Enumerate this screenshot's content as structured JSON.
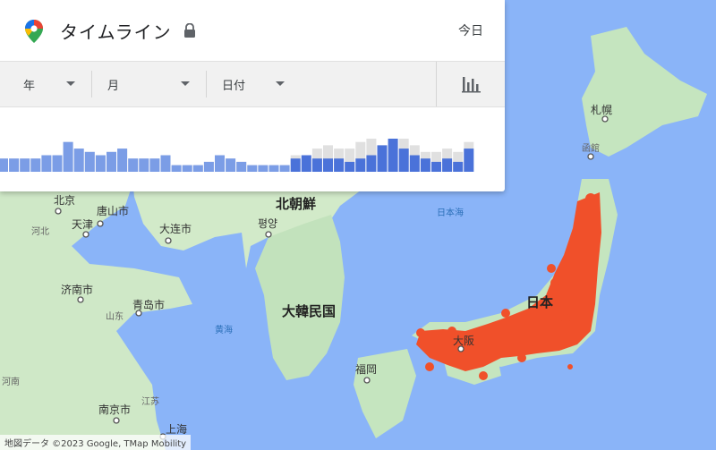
{
  "panel": {
    "title": "タイムライン",
    "today_label": "今日",
    "filters": {
      "year": "年",
      "month": "月",
      "date": "日付"
    }
  },
  "chart_data": {
    "type": "bar",
    "series": [
      {
        "name": "",
        "color": "#e0e0e0",
        "values": [
          4,
          4,
          4,
          4,
          5,
          5,
          9,
          7,
          6,
          5,
          6,
          7,
          4,
          4,
          4,
          5,
          2,
          2,
          2,
          3,
          5,
          4,
          3,
          2,
          2,
          2,
          2,
          5,
          5,
          7,
          8,
          7,
          7,
          9,
          10,
          8,
          10,
          10,
          8,
          6,
          6,
          7,
          6,
          9
        ]
      },
      {
        "name": "",
        "color": "#7b9de6",
        "values": [
          4,
          4,
          4,
          4,
          5,
          5,
          9,
          7,
          6,
          5,
          6,
          7,
          4,
          4,
          4,
          5,
          2,
          2,
          2,
          3,
          5,
          4,
          3,
          2,
          2,
          2,
          2,
          4,
          5,
          4,
          4,
          4,
          3,
          4,
          5,
          8,
          10,
          7,
          5,
          4,
          3,
          4,
          3,
          7
        ]
      }
    ],
    "highlight_color": "#4a72d9",
    "highlight_indices": [
      27,
      28,
      29,
      30,
      31,
      32,
      33,
      34,
      35,
      36,
      37,
      38,
      39,
      40,
      41,
      42,
      43
    ]
  },
  "map": {
    "colors": {
      "land": "#c7e5c3",
      "water": "#8ab4f8",
      "visited": "#f0502a"
    },
    "labels": {
      "beijing": "北京",
      "tangshan": "唐山市",
      "tianjin": "天津",
      "hebei": "河北",
      "dalian": "大连市",
      "north_korea": "北朝鮮",
      "pyongyang": "평양",
      "sea_of_japan": "日本海",
      "sapporo": "札幌",
      "hakodate": "函館",
      "jinan": "济南市",
      "qingdao": "青岛市",
      "shandong": "山东",
      "yellow_sea": "黄海",
      "south_korea": "大韓民国",
      "japan": "日本",
      "osaka": "大阪",
      "fukuoka": "福岡",
      "henan": "河南",
      "nanjing": "南京市",
      "jiangsu": "江苏",
      "shanghai": "上海"
    }
  },
  "attribution": "地図データ ©2023 Google, TMap Mobility"
}
